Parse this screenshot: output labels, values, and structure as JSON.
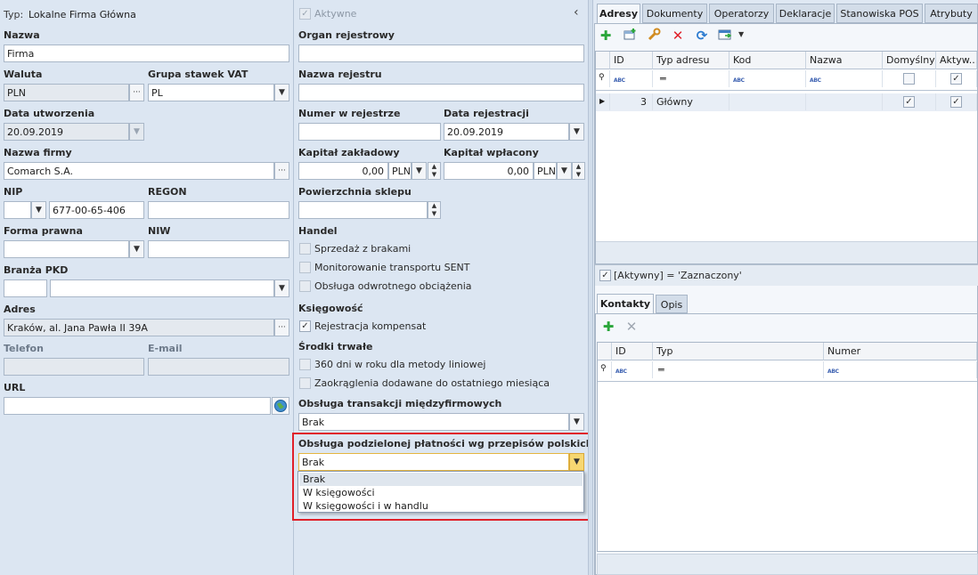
{
  "header": {
    "type_label": "Typ:",
    "type_value": "Lokalne Firma Główna",
    "active_label": "Aktywne",
    "collapse_glyph": "‹"
  },
  "left": {
    "nazwa_label": "Nazwa",
    "nazwa_value": "Firma",
    "waluta_label": "Waluta",
    "waluta_value": "PLN",
    "grupa_vat_label": "Grupa stawek VAT",
    "grupa_vat_value": "PL",
    "data_utworzenia_label": "Data utworzenia",
    "data_utworzenia_value": "20.09.2019",
    "nazwa_firmy_label": "Nazwa firmy",
    "nazwa_firmy_value": "Comarch S.A.",
    "nip_label": "NIP",
    "nip_prefix_value": "",
    "nip_value": "677-00-65-406",
    "regon_label": "REGON",
    "regon_value": "",
    "forma_prawna_label": "Forma prawna",
    "forma_prawna_value": "",
    "niw_label": "NIW",
    "niw_value": "",
    "branza_label": "Branża PKD",
    "adres_label": "Adres",
    "adres_value": "Kraków, al. Jana Pawła II 39A",
    "telefon_label": "Telefon",
    "email_label": "E-mail",
    "url_label": "URL",
    "url_value": ""
  },
  "middle": {
    "organ_label": "Organ rejestrowy",
    "nazwa_rejestru_label": "Nazwa rejestru",
    "numer_label": "Numer w rejestrze",
    "data_rej_label": "Data rejestracji",
    "data_rej_value": "20.09.2019",
    "kapital_zakl_label": "Kapitał zakładowy",
    "kapital_zakl_value": "0,00",
    "kapital_zakl_currency": "PLN",
    "kapital_wpl_label": "Kapitał wpłacony",
    "kapital_wpl_value": "0,00",
    "kapital_wpl_currency": "PLN",
    "powierzchnia_label": "Powierzchnia sklepu",
    "handel_label": "Handel",
    "handel_items": [
      {
        "label": "Sprzedaż z brakami",
        "checked": false
      },
      {
        "label": "Monitorowanie transportu SENT",
        "checked": false
      },
      {
        "label": "Obsługa odwrotnego obciążenia",
        "checked": false
      }
    ],
    "ksiegowosc_label": "Księgowość",
    "ksiegowosc_item": "Rejestracja kompensat",
    "srodki_label": "Środki trwałe",
    "srodki_items": [
      {
        "label": "360 dni w roku dla metody liniowej",
        "checked": false
      },
      {
        "label": "Zaokrąglenia dodawane do ostatniego miesiąca",
        "checked": false
      }
    ],
    "miedzyfirm_label": "Obsługa transakcji międzyfirmowych",
    "miedzyfirm_value": "Brak",
    "split_label": "Obsługa podzielonej płatności wg przepisów polskich",
    "split_value": "Brak",
    "split_options": [
      "Brak",
      "W księgowości",
      "W księgowości i w handlu"
    ]
  },
  "right": {
    "tabs": [
      "Adresy",
      "Dokumenty",
      "Operatorzy",
      "Deklaracje",
      "Stanowiska POS",
      "Atrybuty"
    ],
    "addr_columns": [
      "ID",
      "Typ adresu",
      "Kod",
      "Nazwa",
      "Domyślny",
      "Aktyw..."
    ],
    "addr_row": {
      "id": "3",
      "typ": "Główny"
    },
    "filter_text": "[Aktywny] = 'Zaznaczony'",
    "sub_tabs": [
      "Kontakty",
      "Opis"
    ],
    "contact_columns": [
      "ID",
      "Typ",
      "Numer"
    ],
    "abc": "ABC",
    "eq": "═"
  },
  "accent": "#e0202a"
}
